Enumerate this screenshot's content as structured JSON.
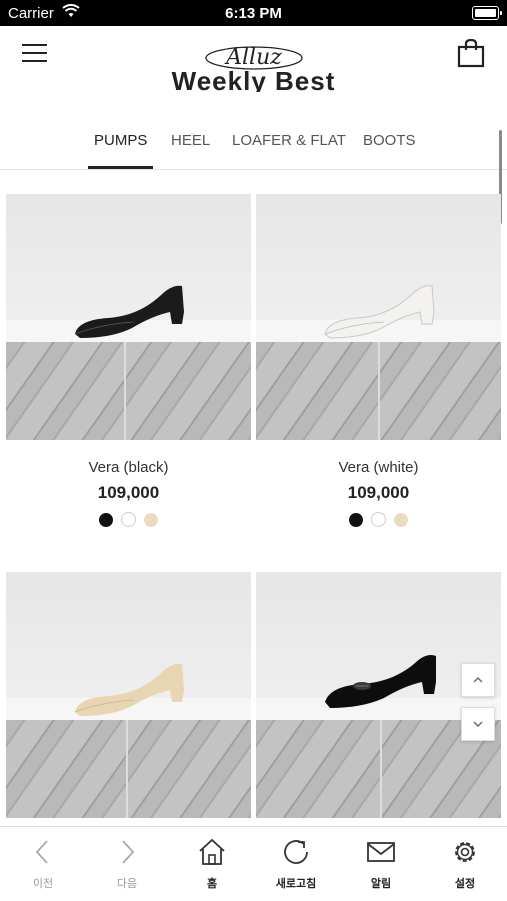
{
  "status_bar": {
    "carrier": "Carrier",
    "time": "6:13 PM"
  },
  "header": {
    "logo_text": "Alluz",
    "section_title": "Weekly Best"
  },
  "tabs": [
    {
      "label": "PUMPS",
      "active": true
    },
    {
      "label": "HEEL",
      "active": false
    },
    {
      "label": "LOAFER & FLAT",
      "active": false
    },
    {
      "label": "BOOTS",
      "active": false
    }
  ],
  "products": [
    {
      "name": "Vera (black)",
      "price": "109,000",
      "shoe_color": "#1b1b1b",
      "swatches": [
        "#111111",
        "#ffffff",
        "#eadcc0"
      ]
    },
    {
      "name": "Vera (white)",
      "price": "109,000",
      "shoe_color": "#f3f2ef",
      "swatches": [
        "#111111",
        "#ffffff",
        "#eadcc0"
      ]
    },
    {
      "shoe_color": "#e8d6b2"
    },
    {
      "shoe_color": "#0d0d0d"
    }
  ],
  "scroll_buttons": {
    "up_icon": "chevron-up-icon",
    "down_icon": "chevron-down-icon"
  },
  "bottom_nav": [
    {
      "label": "이전",
      "icon": "back-arrow-icon"
    },
    {
      "label": "다음",
      "icon": "forward-arrow-icon"
    },
    {
      "label": "홈",
      "icon": "home-icon"
    },
    {
      "label": "새로고침",
      "icon": "refresh-icon"
    },
    {
      "label": "알림",
      "icon": "mail-icon"
    },
    {
      "label": "설정",
      "icon": "settings-gear-icon"
    }
  ]
}
